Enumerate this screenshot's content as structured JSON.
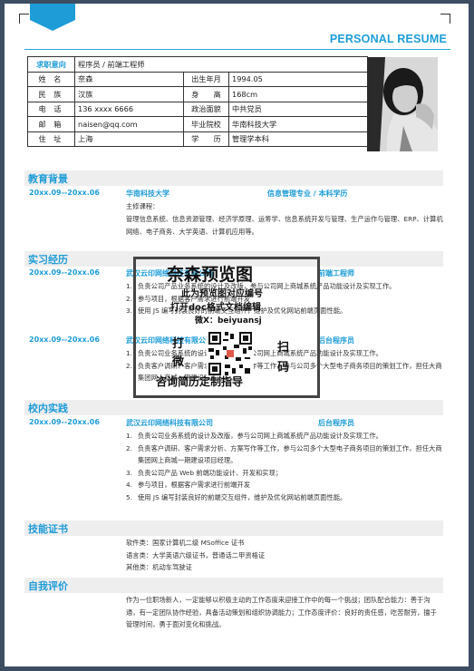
{
  "header": {
    "title_en": "PERSONAL RESUME"
  },
  "info": {
    "job_label": "求职意向",
    "job_value": "程序员 / 前端工程师",
    "rows": [
      {
        "l1": "姓 名",
        "v1": "奈森",
        "l2": "出生年月",
        "v2": "1994.05"
      },
      {
        "l1": "民 族",
        "v1": "汉族",
        "l2": "身　　高",
        "v2": "168cm"
      },
      {
        "l1": "电 话",
        "v1": "136 xxxx 6666",
        "l2": "政治面貌",
        "v2": "中共党员"
      },
      {
        "l1": "邮 箱",
        "v1": "naisen@qq.com",
        "l2": "毕业院校",
        "v2": "华南科技大学"
      },
      {
        "l1": "住 址",
        "v1": "上海",
        "l2": "学　　历",
        "v2": "管理学本科"
      }
    ]
  },
  "education": {
    "title": "教育背景",
    "date": "20xx.09--20xx.06",
    "school": "华南科技大学",
    "major": "信息管理专业 / 本科学历",
    "course_label": "主修课程：",
    "courses": "管理信息系统、信息资源管理、经济学原理、运筹学、信息系统开发与管理、生产运作与管理、ERP、计算机网络、电子商务、大学英语、计算机应用等。"
  },
  "internship": {
    "title": "实习经历",
    "job1": {
      "date": "20xx.09--20xx.06",
      "company": "武汉云印网络科技有限公司",
      "role": "前端工程师",
      "items": [
        "负责公司产品业务系统的设计及改版，参与公司网上商城系统产品功能设计及实现工作。",
        "参与项目，根据客户需求进行前端开发",
        "使用 JS 编写封装良好的前端交互组件，维护及优化网站前端页面性能。"
      ]
    },
    "job2": {
      "date": "20xx.09--20xx.06",
      "company": "武汉云印网络科技有限公司",
      "role": "后台程序员",
      "items": [
        "负责公司业务系统的设计及改版，参与公司网上商城系统产品功能设计及实现工作。",
        "负责客户调研、客户需求分析、方案写作等工作，参与公司多个大型电子商务项目的策划工作，担任大商集团网上商城一期建设项目经理。"
      ]
    }
  },
  "campus": {
    "title": "校内实践",
    "date": "20xx.09--20xx.06",
    "company": "武汉云印网络科技有限公司",
    "role": "后台程序员",
    "items": [
      "负责公司业务系统的设计及改版，参与公司网上商城系统产品功能设计及实现工作。",
      "负责客户调研、客户需求分析、方案写作等工作，参与公司多个大型电子商务项目的策划工作，担任大商集团网上商城一期建设项目经理。",
      "负责公司产品 Web 前端功能设计、开发和实现；",
      "参与项目，根据客户需求进行前端开发",
      "使用 JS 编写封装良好的前端交互组件，维护及优化网站前端页面性能。"
    ]
  },
  "skills": {
    "title": "技能证书",
    "lines": [
      "软件类：国家计算机二级 MSoffice 证书",
      "语言类：大学英语六级证书，普通话二甲资格证",
      "其他类：机动车驾驶证"
    ]
  },
  "evaluation": {
    "title": "自我评价",
    "text": "作为一位职场新人，一定能够以积极主动的工作态度来迎接工作中的每一个挑战；团队配合能力：善于沟通，有一定团队协作经验，具备活动策划和组织协调能力；工作态度评价：良好的责任感，吃苦耐劳，擅于管理时间，勇于面对变化和挑战。"
  },
  "watermark": {
    "title": "奈森预览图",
    "line1": "此为预览图对应编号",
    "line2": "打开doc格式文档编辑",
    "wechat": "微X：beiyuansj",
    "scan_left": "打",
    "scan_left2": "微",
    "scan_right": "扫",
    "scan_right2": "码",
    "footer": "咨询简历定制指导"
  }
}
